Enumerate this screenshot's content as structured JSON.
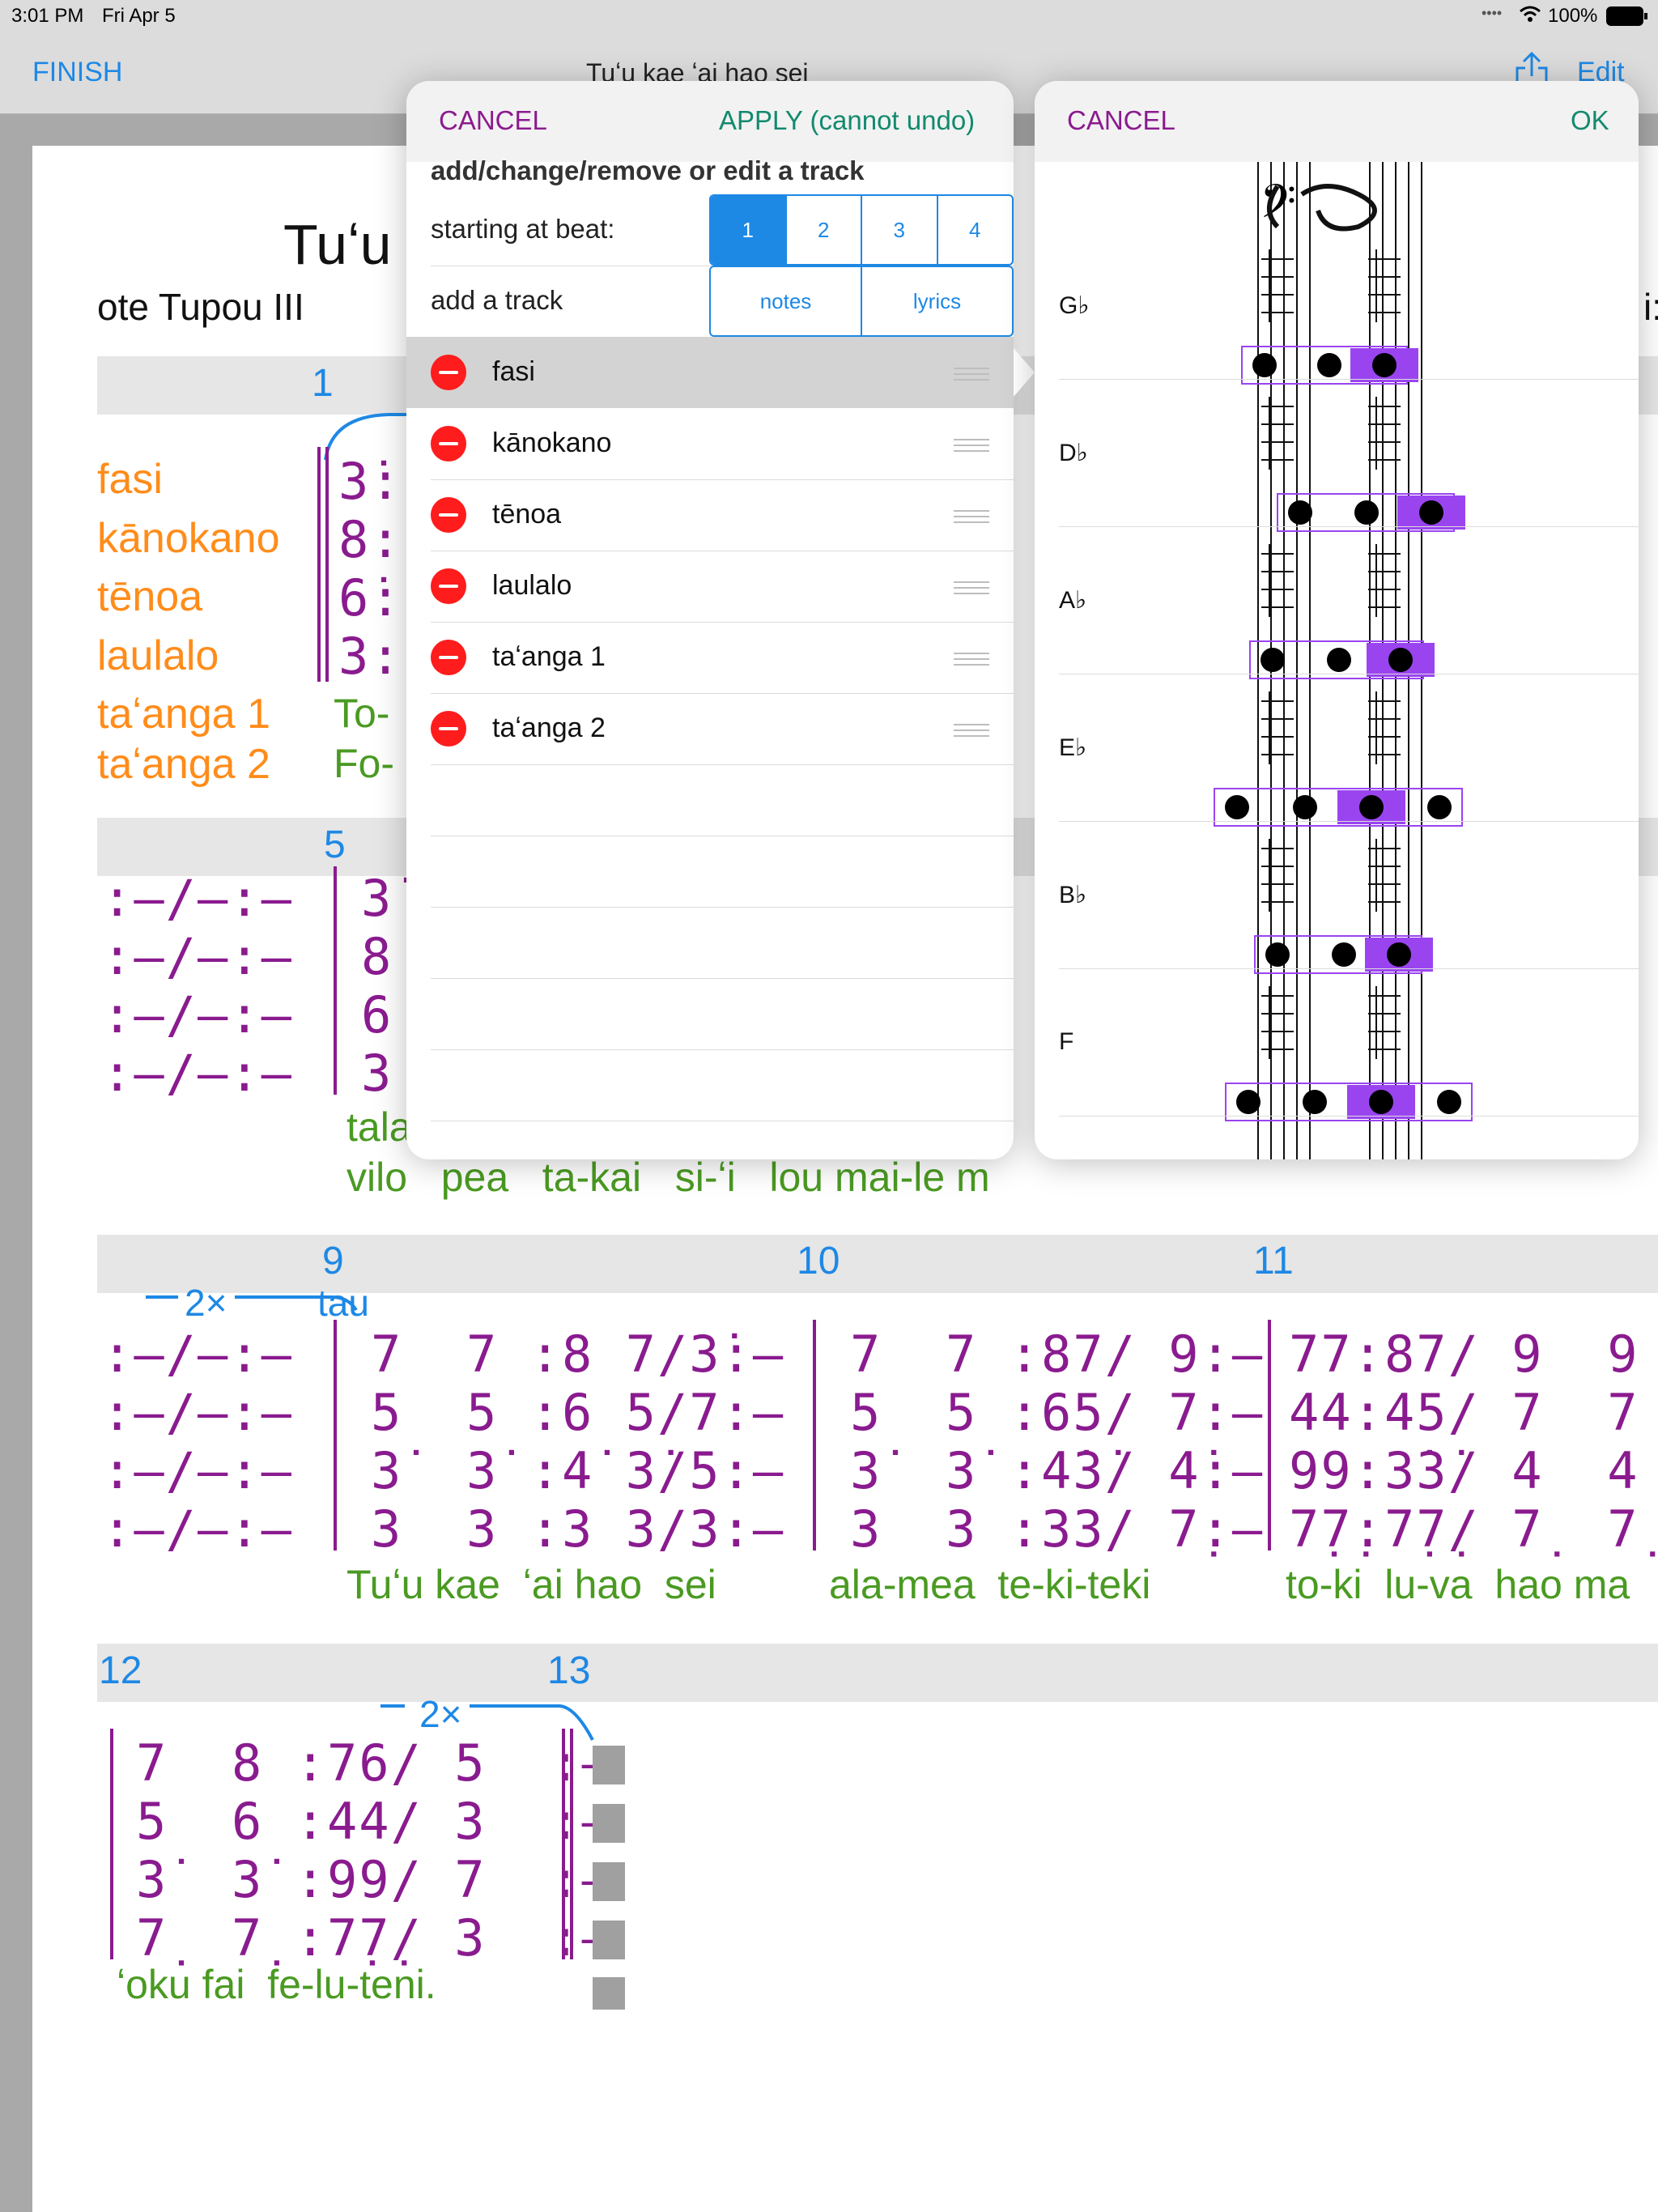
{
  "status": {
    "time": "3:01 PM",
    "date": "Fri Apr 5",
    "battery": "100%"
  },
  "nav": {
    "finish": "FINISH",
    "title": "Tuʻu kae ʻai hao sei",
    "edit": "Edit"
  },
  "sheet": {
    "title": "Tuʻu",
    "composer": "ote Tupou III",
    "right_partial": "i:",
    "tracks": [
      "fasi",
      "kānokano",
      "tēnoa",
      "laulalo",
      "taʻanga 1",
      "taʻanga 2"
    ],
    "sys1": {
      "measure": "1",
      "notes": [
        "3̇:",
        "8:",
        "6̇:",
        "3:"
      ],
      "lyric1": "To-",
      "lyric2": "Fo-"
    },
    "sys2": {
      "measure": "5",
      "pickup": ":–/–:–",
      "notes": [
        "3̇",
        "8",
        "6",
        "3"
      ],
      "lyric1": "tala",
      "lyric2": "vilo   pea   ta-kai   si-ʻi   lou mai-le m"
    },
    "sys3": {
      "measures": [
        "9",
        "10",
        "11"
      ],
      "repeat": "2×",
      "tau": "tau",
      "pickup": ":–/–:–",
      "m9": [
        "7  7 :8 7/3̇:–",
        "5  5 :6 5/7:–",
        "3̇  3̇ :4̇ 3̇/5:–",
        "3  3 :3 3/3:–"
      ],
      "m10": [
        "7  7 :87/ 9:–",
        "5  5 :65/ 7:–",
        "3̇  3̇ :4̇3̇/ 4̇:–",
        "3  3 :33/ 7̣:–"
      ],
      "m11": [
        "77:87/ 9  9",
        "44:45/ 7  7",
        "99:3̇3̇/ 4  4",
        "7̣7̣:7̣7̣/ 7̣  7̣"
      ],
      "lyrics": [
        "Tuʻu kae  ʻai hao  sei",
        "ala-mea  te-ki-teki",
        "to-ki  lu-va  hao ma"
      ]
    },
    "sys4": {
      "measures": [
        "12",
        "13"
      ],
      "repeat": "2×",
      "notes": [
        "7  8 :76/ 5  :–",
        "5  6 :44/ 3  :–",
        "3̇  3̇ :99/ 7  :–",
        "7̣  7̣ :7̣7̣/ 3  :–"
      ],
      "lyric": "ʻoku fai  fe-lu-teni."
    }
  },
  "pop1": {
    "cancel": "CANCEL",
    "apply": "APPLY (cannot undo)",
    "heading": "add/change/remove or edit a track",
    "beat_label": "starting at beat:",
    "beats": [
      "1",
      "2",
      "3",
      "4"
    ],
    "selected_beat": "1",
    "add_label": "add a track",
    "add_options": [
      "notes",
      "lyrics"
    ],
    "tracks": [
      "fasi",
      "kānokano",
      "tēnoa",
      "laulalo",
      "taʻanga 1",
      "taʻanga 2"
    ]
  },
  "pop2": {
    "cancel": "CANCEL",
    "ok": "OK",
    "keys": [
      "G♭",
      "D♭",
      "A♭",
      "E♭",
      "B♭",
      "F"
    ],
    "selected_key": "G♭"
  },
  "colors": {
    "accent": "#1e88e5",
    "purple": "#8a1b8f",
    "orange": "#ff8c1a",
    "green": "#4a9a22",
    "delete": "#ff1c1c",
    "highlight": "#9a44f0"
  }
}
